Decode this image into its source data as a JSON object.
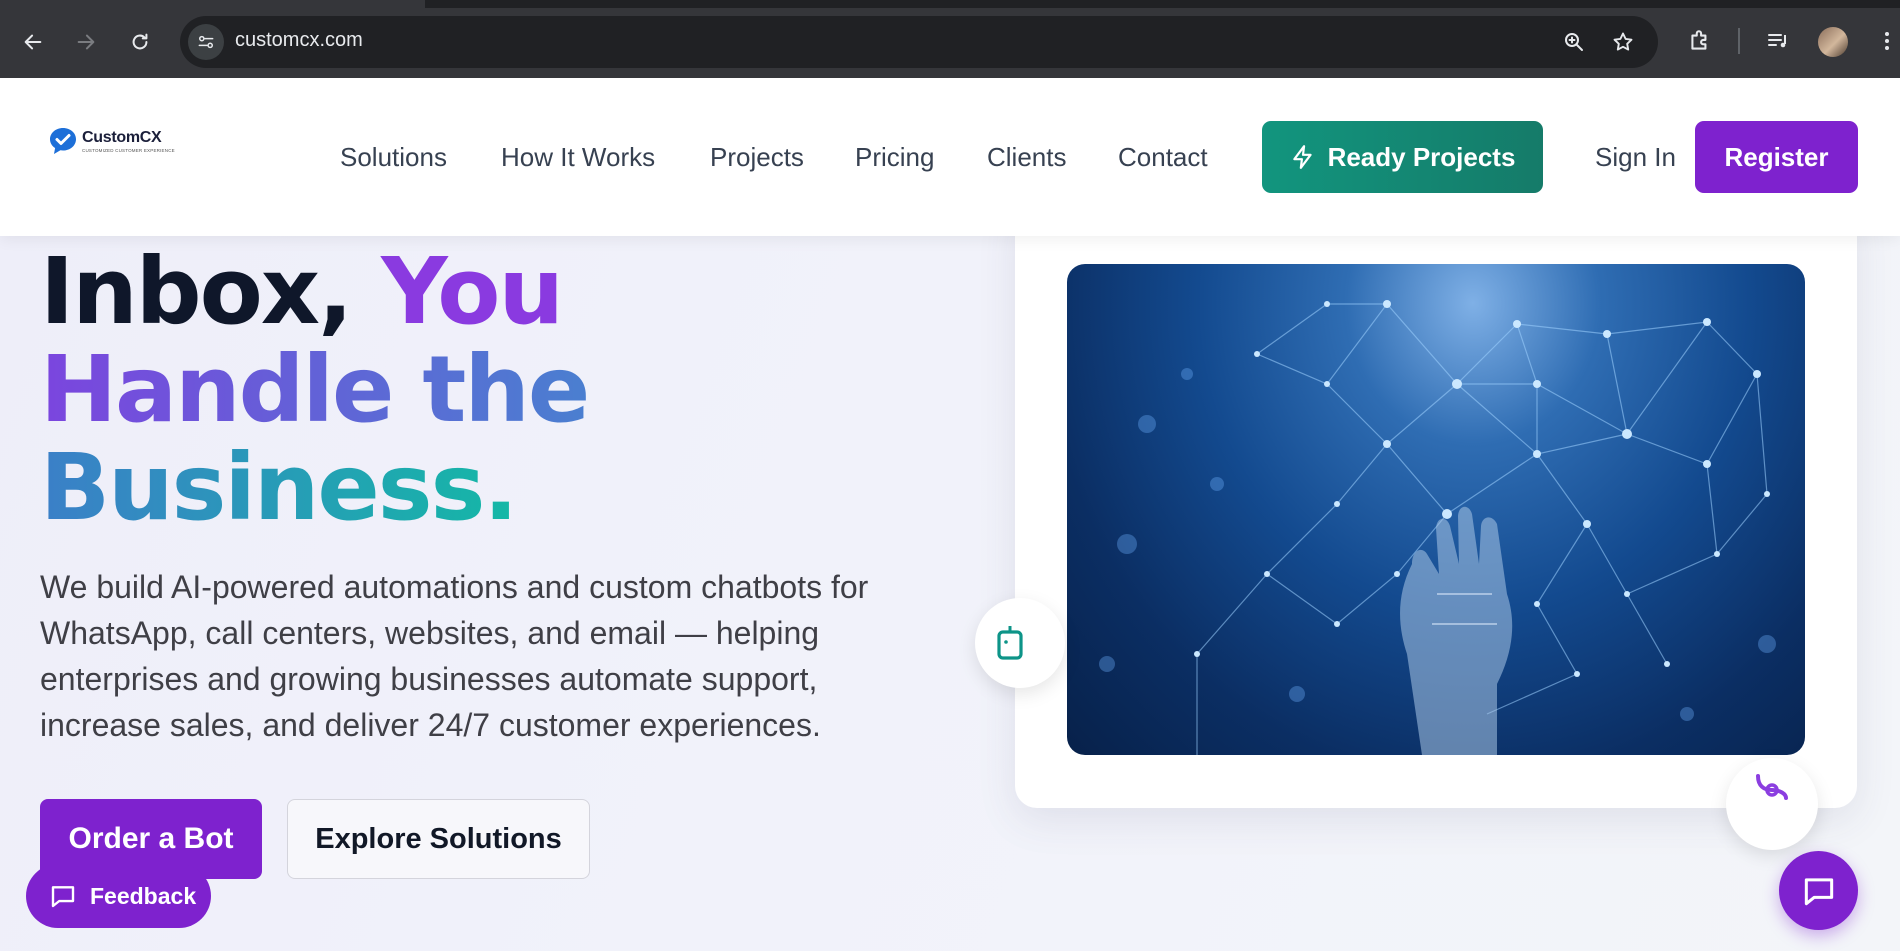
{
  "browser": {
    "url": "customcx.com",
    "icons": [
      "back-icon",
      "forward-icon",
      "reload-icon",
      "site-info-icon",
      "zoom-icon",
      "star-icon",
      "extensions-icon",
      "media-icon",
      "profile-avatar",
      "menu-icon"
    ]
  },
  "header": {
    "logo": {
      "name": "CustomCX",
      "tagline": "CUSTOMIZED CUSTOMER EXPERIENCE"
    },
    "nav": [
      "Solutions",
      "How It Works",
      "Projects",
      "Pricing",
      "Clients",
      "Contact"
    ],
    "ready_projects": "Ready Projects",
    "sign_in": "Sign In",
    "register": "Register"
  },
  "hero": {
    "title_part1": "Inbox,",
    "title_part2": "You",
    "title_line2": "Handle the",
    "title_line3": "Business.",
    "description": "We build AI-powered automations and custom chatbots for WhatsApp, call centers, websites, and email — helping enterprises and growing businesses automate support, increase sales, and deliver 24/7 customer experiences.",
    "primary_cta": "Order a Bot",
    "secondary_cta": "Explore Solutions"
  },
  "feedback_label": "Feedback",
  "colors": {
    "brand_purple": "#7e22ce",
    "teal": "#12957e",
    "dark_text": "#0f172a"
  }
}
